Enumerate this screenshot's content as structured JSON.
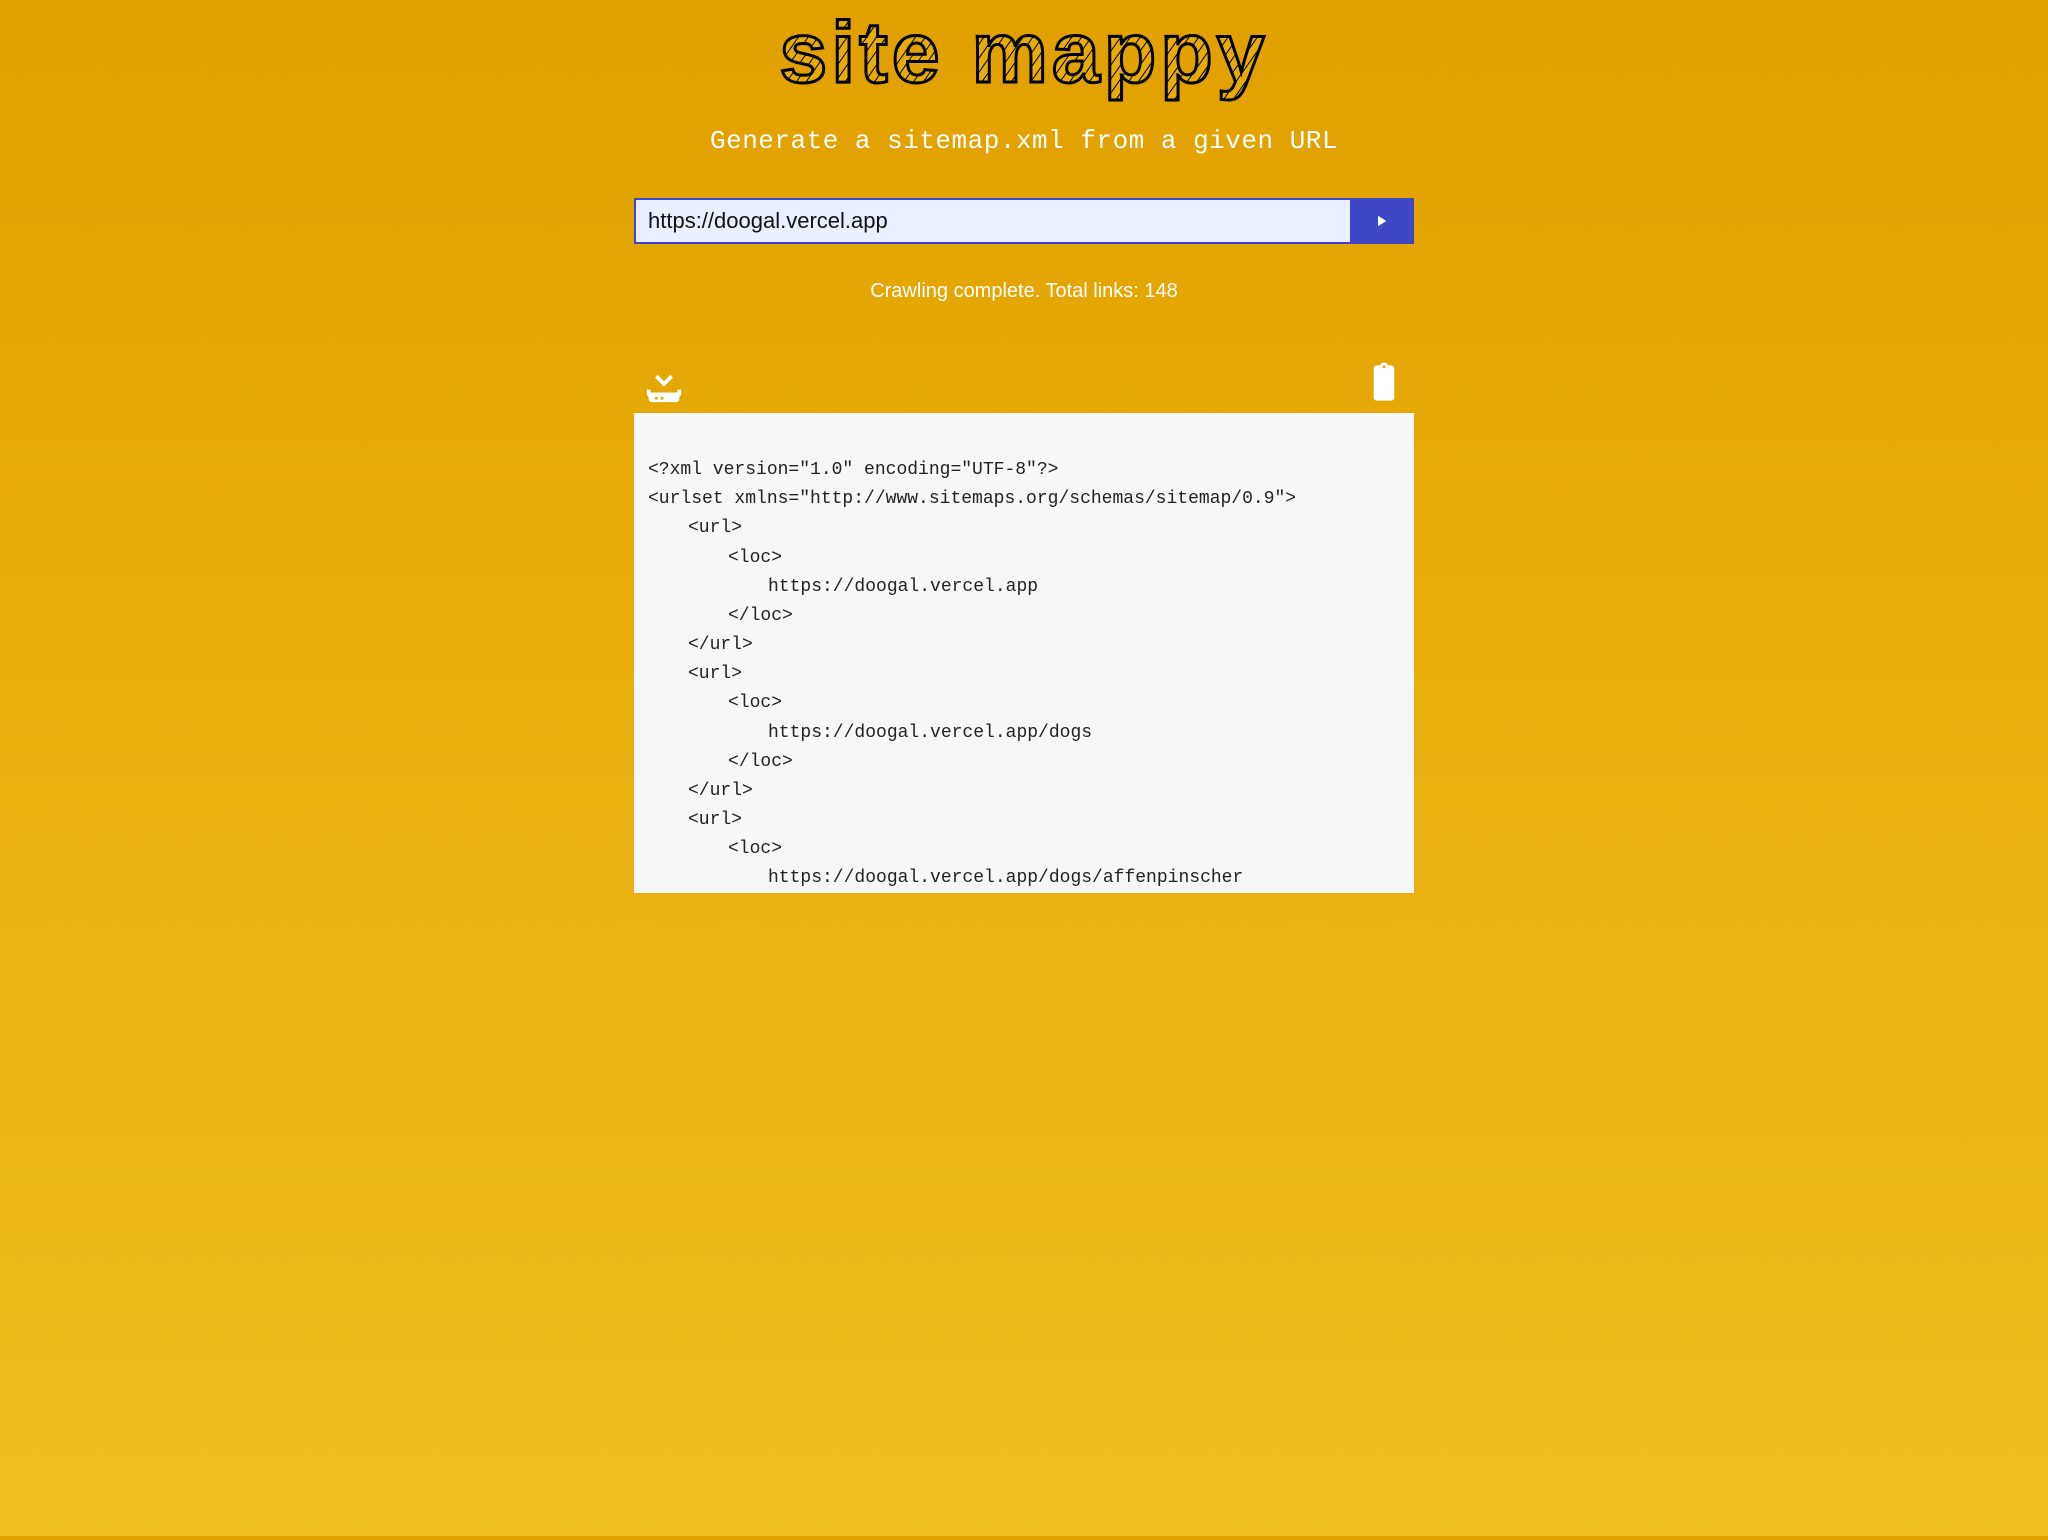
{
  "title": "site mappy",
  "subtitle": "Generate a sitemap.xml from a given URL",
  "form": {
    "url_value": "https://doogal.vercel.app"
  },
  "status": {
    "prefix": "Crawling complete. Total links: ",
    "count": "148"
  },
  "toolbar": {
    "download_label": "Download sitemap",
    "copy_label": "Copy to clipboard"
  },
  "xml": {
    "line_decl": "<?xml version=\"1.0\" encoding=\"UTF-8\"?>",
    "line_urlset": "<urlset xmlns=\"http://www.sitemaps.org/schemas/sitemap/0.9\">",
    "tag_url_open": "<url>",
    "tag_url_close": "</url>",
    "tag_loc_open": "<loc>",
    "tag_loc_close": "</loc>",
    "loc1": "https://doogal.vercel.app",
    "loc2": "https://doogal.vercel.app/dogs",
    "loc3": "https://doogal.vercel.app/dogs/affenpinscher"
  }
}
